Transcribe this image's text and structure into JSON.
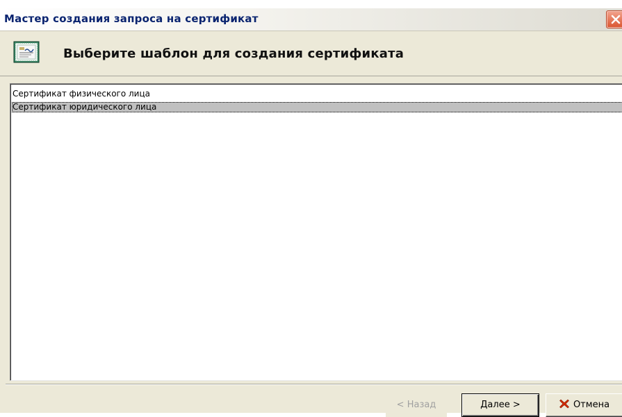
{
  "window": {
    "title": "Мастер создания запроса на сертификат"
  },
  "header": {
    "title": "Выберите шаблон для создания сертификата",
    "icon": "certificate-icon"
  },
  "templates": {
    "items": [
      {
        "label": "Сертификат физического лица",
        "selected": false
      },
      {
        "label": "Сертификат юридического лица",
        "selected": true
      }
    ]
  },
  "buttons": {
    "back_label": "< Назад",
    "next_label": "Далее >",
    "cancel_label": "Отмена",
    "cancel_icon": "red-x-icon"
  },
  "colors": {
    "title_text": "#0a2470",
    "dialog_bg": "#ece9d8",
    "selection_bg": "#c0c0c0",
    "cancel_icon": "#d42a00"
  }
}
